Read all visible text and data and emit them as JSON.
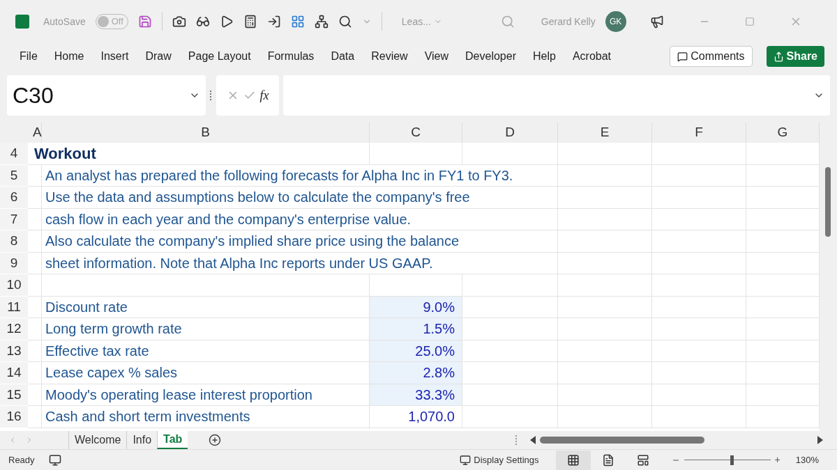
{
  "title_bar": {
    "autosave_label": "AutoSave",
    "autosave_state": "Off",
    "autosave_on": false,
    "file_name": "Leas...",
    "user_name": "Gerard Kelly",
    "user_initials": "GK"
  },
  "ribbon": {
    "tabs": [
      {
        "label": "File",
        "selected": false
      },
      {
        "label": "Home",
        "selected": false
      },
      {
        "label": "Insert",
        "selected": false
      },
      {
        "label": "Draw",
        "selected": false
      },
      {
        "label": "Page Layout",
        "selected": false
      },
      {
        "label": "Formulas",
        "selected": false
      },
      {
        "label": "Data",
        "selected": false
      },
      {
        "label": "Review",
        "selected": false
      },
      {
        "label": "View",
        "selected": false
      },
      {
        "label": "Developer",
        "selected": false
      },
      {
        "label": "Help",
        "selected": false
      },
      {
        "label": "Acrobat",
        "selected": false
      }
    ],
    "comments_button": "Comments",
    "share_button": "Share"
  },
  "formula_bar": {
    "name_box": "C30",
    "fx_label": "fx"
  },
  "sheet": {
    "columns": [
      "A",
      "B",
      "C",
      "D",
      "E",
      "F",
      "G"
    ],
    "rows": [
      {
        "number": "4",
        "kind": "heading",
        "label": "Workout"
      },
      {
        "number": "5",
        "kind": "text",
        "label": "An analyst has prepared the following forecasts for Alpha Inc in FY1 to FY3."
      },
      {
        "number": "6",
        "kind": "text",
        "label": "Use the data and assumptions below to calculate the company's free"
      },
      {
        "number": "7",
        "kind": "text",
        "label": "cash flow in each year and the company's enterprise value."
      },
      {
        "number": "8",
        "kind": "text",
        "label": "Also calculate the company's implied share price using the balance"
      },
      {
        "number": "9",
        "kind": "text",
        "label": "sheet information. Note that Alpha Inc reports under US GAAP."
      },
      {
        "number": "10",
        "kind": "blank"
      },
      {
        "number": "11",
        "kind": "input",
        "label": "Discount rate",
        "value": "9.0%",
        "highlighted": true
      },
      {
        "number": "12",
        "kind": "input",
        "label": "Long term growth rate",
        "value": "1.5%",
        "highlighted": true
      },
      {
        "number": "13",
        "kind": "input",
        "label": "Effective tax rate",
        "value": "25.0%",
        "highlighted": true
      },
      {
        "number": "14",
        "kind": "input",
        "label": "Lease capex % sales",
        "value": "2.8%",
        "highlighted": true
      },
      {
        "number": "15",
        "kind": "input",
        "label": "Moody's operating lease interest proportion",
        "value": "33.3%",
        "highlighted": true
      },
      {
        "number": "16",
        "kind": "input",
        "label": "Cash and short term investments",
        "value": "1,070.0",
        "highlighted": false
      }
    ]
  },
  "sheet_tabs": [
    {
      "label": "Welcome",
      "selected": false
    },
    {
      "label": "Info",
      "selected": false
    },
    {
      "label": "Tab",
      "selected": true
    }
  ],
  "status_bar": {
    "status": "Ready",
    "display_settings": "Display Settings",
    "views": [
      {
        "kind": "normal",
        "selected": true
      },
      {
        "kind": "page_layout",
        "selected": false
      },
      {
        "kind": "page_break",
        "selected": false
      }
    ],
    "zoom": {
      "level": 0.55
    },
    "zoom_in_label": "+",
    "zoom_text": "130%"
  }
}
